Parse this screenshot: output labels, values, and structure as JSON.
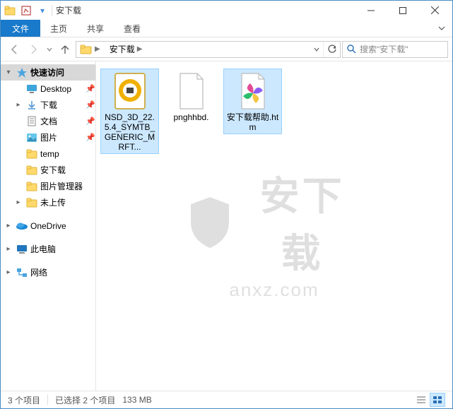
{
  "title": "安下载",
  "ribbon": {
    "file": "文件",
    "home": "主页",
    "share": "共享",
    "view": "查看"
  },
  "address": {
    "root_icon_name": "folder-icon",
    "crumb": "安下载"
  },
  "search": {
    "placeholder": "搜索\"安下载\""
  },
  "sidebar": {
    "quick": "快速访问",
    "items": [
      {
        "label": "Desktop",
        "icon": "desktop-icon",
        "pin": true
      },
      {
        "label": "下载",
        "icon": "downloads-icon",
        "pin": true
      },
      {
        "label": "文档",
        "icon": "documents-icon",
        "pin": true
      },
      {
        "label": "图片",
        "icon": "pictures-icon",
        "pin": true
      },
      {
        "label": "temp",
        "icon": "folder-icon",
        "pin": false
      },
      {
        "label": "安下载",
        "icon": "folder-icon",
        "pin": false
      },
      {
        "label": "图片管理器",
        "icon": "folder-icon",
        "pin": false
      },
      {
        "label": "未上传",
        "icon": "folder-icon",
        "pin": false
      }
    ],
    "onedrive": "OneDrive",
    "thispc": "此电脑",
    "network": "网络"
  },
  "files": [
    {
      "label": "NSD_3D_22.5.4_SYMTB_GENERIC_MRFT...",
      "icon": "app-shield-icon",
      "selected": true
    },
    {
      "label": "pnghhbd.",
      "icon": "blank-file-icon",
      "selected": false
    },
    {
      "label": "安下载帮助.htm",
      "icon": "pinwheel-icon",
      "selected": true
    }
  ],
  "status": {
    "count": "3 个项目",
    "selected": "已选择 2 个项目",
    "size": "133 MB"
  },
  "watermark": {
    "line1": "安下载",
    "line2": "anxz.com"
  }
}
